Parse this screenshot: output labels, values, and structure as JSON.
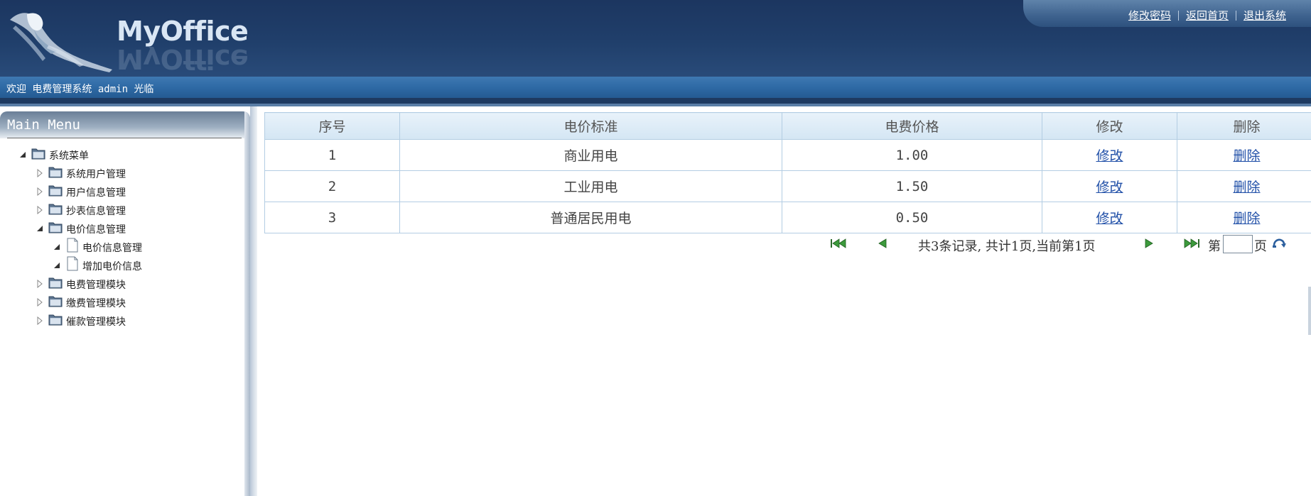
{
  "header": {
    "logo_text": "MyOffice",
    "links": [
      {
        "label": "修改密码"
      },
      {
        "label": "返回首页"
      },
      {
        "label": "退出系统"
      }
    ]
  },
  "welcome": {
    "text": "欢迎 电费管理系统 admin 光临"
  },
  "sidebar": {
    "title": "Main Menu",
    "tree": [
      {
        "label": "系统菜单",
        "level": 0,
        "expanded": true,
        "icon": "folder-icon"
      },
      {
        "label": "系统用户管理",
        "level": 1,
        "expanded": false,
        "icon": "folder-icon"
      },
      {
        "label": "用户信息管理",
        "level": 1,
        "expanded": false,
        "icon": "folder-icon"
      },
      {
        "label": "抄表信息管理",
        "level": 1,
        "expanded": false,
        "icon": "folder-icon"
      },
      {
        "label": "电价信息管理",
        "level": 1,
        "expanded": true,
        "icon": "folder-icon"
      },
      {
        "label": "电价信息管理",
        "level": 2,
        "expanded": true,
        "icon": "page-icon"
      },
      {
        "label": "增加电价信息",
        "level": 2,
        "expanded": true,
        "icon": "page-icon"
      },
      {
        "label": "电费管理模块",
        "level": 1,
        "expanded": false,
        "icon": "folder-icon"
      },
      {
        "label": "缴费管理模块",
        "level": 1,
        "expanded": false,
        "icon": "folder-icon"
      },
      {
        "label": "催款管理模块",
        "level": 1,
        "expanded": false,
        "icon": "folder-icon"
      }
    ]
  },
  "table": {
    "headers": [
      "序号",
      "电价标准",
      "电费价格",
      "修改",
      "删除"
    ],
    "rows": [
      {
        "id": "1",
        "standard": "商业用电",
        "price": "1.00",
        "edit": "修改",
        "delete": "删除"
      },
      {
        "id": "2",
        "standard": "工业用电",
        "price": "1.50",
        "edit": "修改",
        "delete": "删除"
      },
      {
        "id": "3",
        "standard": "普通居民用电",
        "price": "0.50",
        "edit": "修改",
        "delete": "删除"
      }
    ]
  },
  "pager": {
    "info": "共3条记录, 共计1页,当前第1页",
    "page_prefix": "第",
    "page_suffix": "页",
    "page_value": ""
  },
  "colors": {
    "header_bg": "#203f6b",
    "welcome_bg": "#2e6aa5",
    "table_border": "#b3cde3",
    "link": "#2150a8"
  }
}
